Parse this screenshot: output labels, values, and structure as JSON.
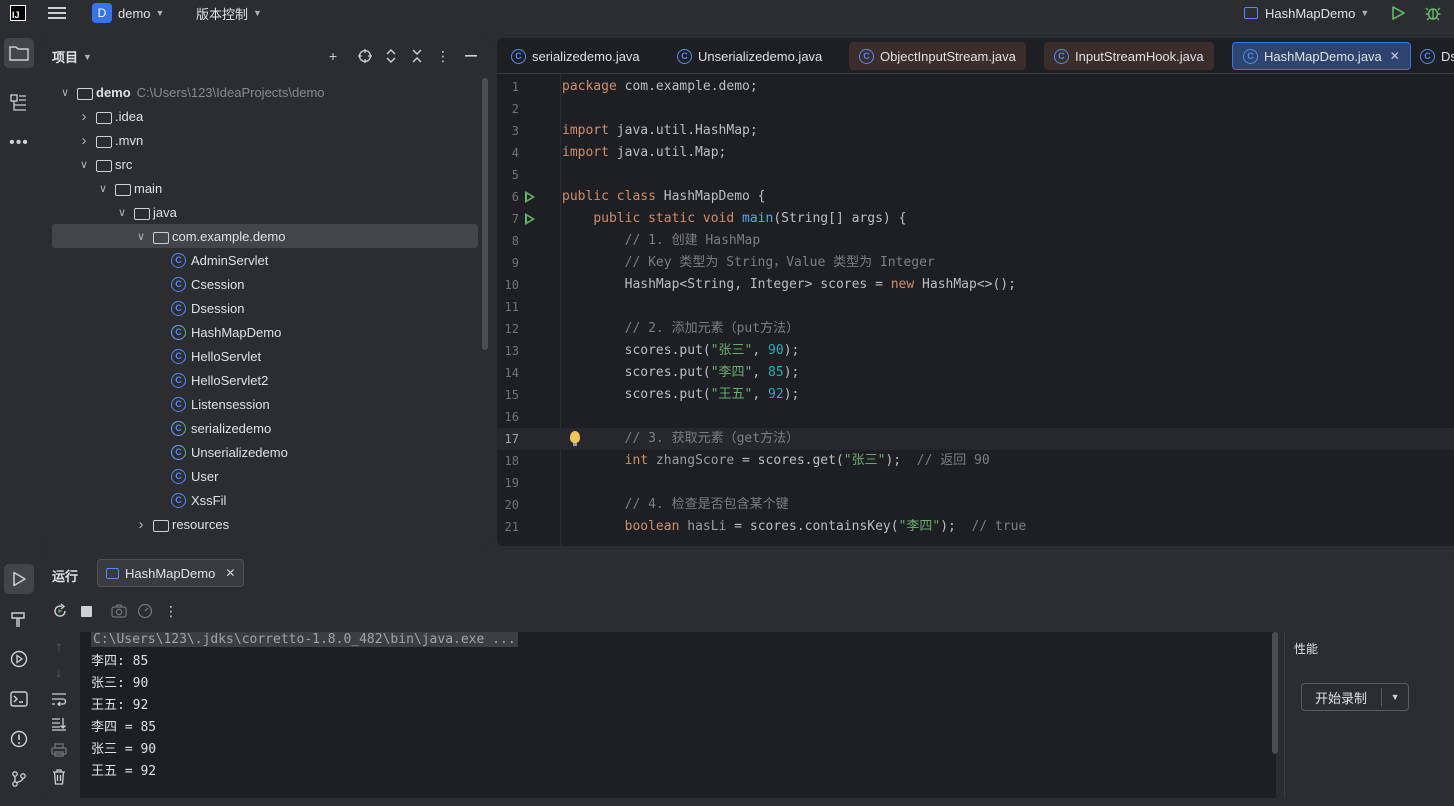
{
  "titlebar": {
    "project_badge": "D",
    "project_name": "demo",
    "vcs_label": "版本控制",
    "run_config": "HashMapDemo"
  },
  "project_panel": {
    "title": "项目",
    "tree": [
      {
        "label": "demo",
        "hint": "C:\\Users\\123\\IdeaProjects\\demo",
        "kind": "module",
        "expanded": true
      },
      {
        "label": ".idea",
        "kind": "folder",
        "expanded": false
      },
      {
        "label": ".mvn",
        "kind": "folder",
        "expanded": false
      },
      {
        "label": "src",
        "kind": "folder",
        "expanded": true
      },
      {
        "label": "main",
        "kind": "folder",
        "expanded": true
      },
      {
        "label": "java",
        "kind": "source-folder",
        "expanded": true
      },
      {
        "label": "com.example.demo",
        "kind": "package",
        "expanded": true,
        "selected": true
      },
      {
        "label": "AdminServlet",
        "kind": "class"
      },
      {
        "label": "Csession",
        "kind": "class"
      },
      {
        "label": "Dsession",
        "kind": "class"
      },
      {
        "label": "HashMapDemo",
        "kind": "runnable-class"
      },
      {
        "label": "HelloServlet",
        "kind": "class"
      },
      {
        "label": "HelloServlet2",
        "kind": "class"
      },
      {
        "label": "Listensession",
        "kind": "class"
      },
      {
        "label": "serializedemo",
        "kind": "runnable-class"
      },
      {
        "label": "Unserializedemo",
        "kind": "runnable-class"
      },
      {
        "label": "User",
        "kind": "class"
      },
      {
        "label": "XssFil",
        "kind": "class"
      },
      {
        "label": "resources",
        "kind": "folder",
        "expanded": false
      }
    ]
  },
  "editor": {
    "tabs": [
      {
        "label": "serializedemo.java",
        "modified": false
      },
      {
        "label": "Unserializedemo.java",
        "modified": false
      },
      {
        "label": "ObjectInputStream.java",
        "modified": true
      },
      {
        "label": "InputStreamHook.java",
        "modified": true
      },
      {
        "label": "HashMapDemo.java",
        "active": true
      },
      {
        "label": "Ds",
        "modified": false
      }
    ],
    "current_line": "17",
    "lines": [
      {
        "n": "1"
      },
      {
        "n": "2"
      },
      {
        "n": "3"
      },
      {
        "n": "4"
      },
      {
        "n": "5"
      },
      {
        "n": "6"
      },
      {
        "n": "7"
      },
      {
        "n": "8"
      },
      {
        "n": "9"
      },
      {
        "n": "10"
      },
      {
        "n": "11"
      },
      {
        "n": "12"
      },
      {
        "n": "13"
      },
      {
        "n": "14"
      },
      {
        "n": "15"
      },
      {
        "n": "16"
      },
      {
        "n": "17"
      },
      {
        "n": "18"
      },
      {
        "n": "19"
      },
      {
        "n": "20"
      },
      {
        "n": "21"
      }
    ],
    "code": {
      "l1_kw": "package",
      "l1_rest": " com.example.demo;",
      "l3_kw": "import",
      "l3_rest": " java.util.HashMap;",
      "l4_kw": "import",
      "l4_rest": " java.util.Map;",
      "l6_kw": "public class",
      "l6_rest": " HashMapDemo {",
      "l7_kw": "public static void",
      "l7_fn": "main",
      "l7_rest": "(String[] args) {",
      "l8": "// 1. 创建 HashMap",
      "l9": "// Key 类型为 String，Value 类型为 Integer",
      "l10_a": "HashMap<String, Integer> scores = ",
      "l10_kw": "new",
      "l10_b": " HashMap<>();",
      "l12": "// 2. 添加元素（put方法）",
      "l13_a": "scores.put(",
      "l13_s": "\"张三\"",
      "l13_b": ", ",
      "l13_n": "90",
      "l13_c": ");",
      "l14_a": "scores.put(",
      "l14_s": "\"李四\"",
      "l14_b": ", ",
      "l14_n": "85",
      "l14_c": ");",
      "l15_a": "scores.put(",
      "l15_s": "\"王五\"",
      "l15_b": ", ",
      "l15_n": "92",
      "l15_c": ");",
      "l17": "// 3. 获取元素（get方法）",
      "l18_kw": "int",
      "l18_v": " zhangScore",
      "l18_a": " = scores.get(",
      "l18_s": "\"张三\"",
      "l18_b": ");  ",
      "l18_c": "// 返回 90",
      "l20": "// 4. 检查是否包含某个键",
      "l21_kw": "boolean",
      "l21_v": " hasLi",
      "l21_a": " = scores.containsKey(",
      "l21_s": "\"李四\"",
      "l21_b": ");  ",
      "l21_c": "// true"
    }
  },
  "run_panel": {
    "title": "运行",
    "tab_label": "HashMapDemo",
    "console": [
      "C:\\Users\\123\\.jdks\\corretto-1.8.0_482\\bin\\java.exe ...",
      "李四: 85",
      "张三: 90",
      "王五: 92",
      "李四 = 85",
      "张三 = 90",
      "王五 = 92"
    ],
    "performance": {
      "title": "性能",
      "record_button": "开始录制"
    }
  },
  "colors": {
    "background": "#2b2d30",
    "editor_bg": "#1e1f22",
    "accent": "#3574f0",
    "keyword": "#cf8e6d",
    "string": "#6aab73",
    "number": "#2aacb8",
    "comment": "#7a7e85",
    "run_green": "#5fb865"
  }
}
